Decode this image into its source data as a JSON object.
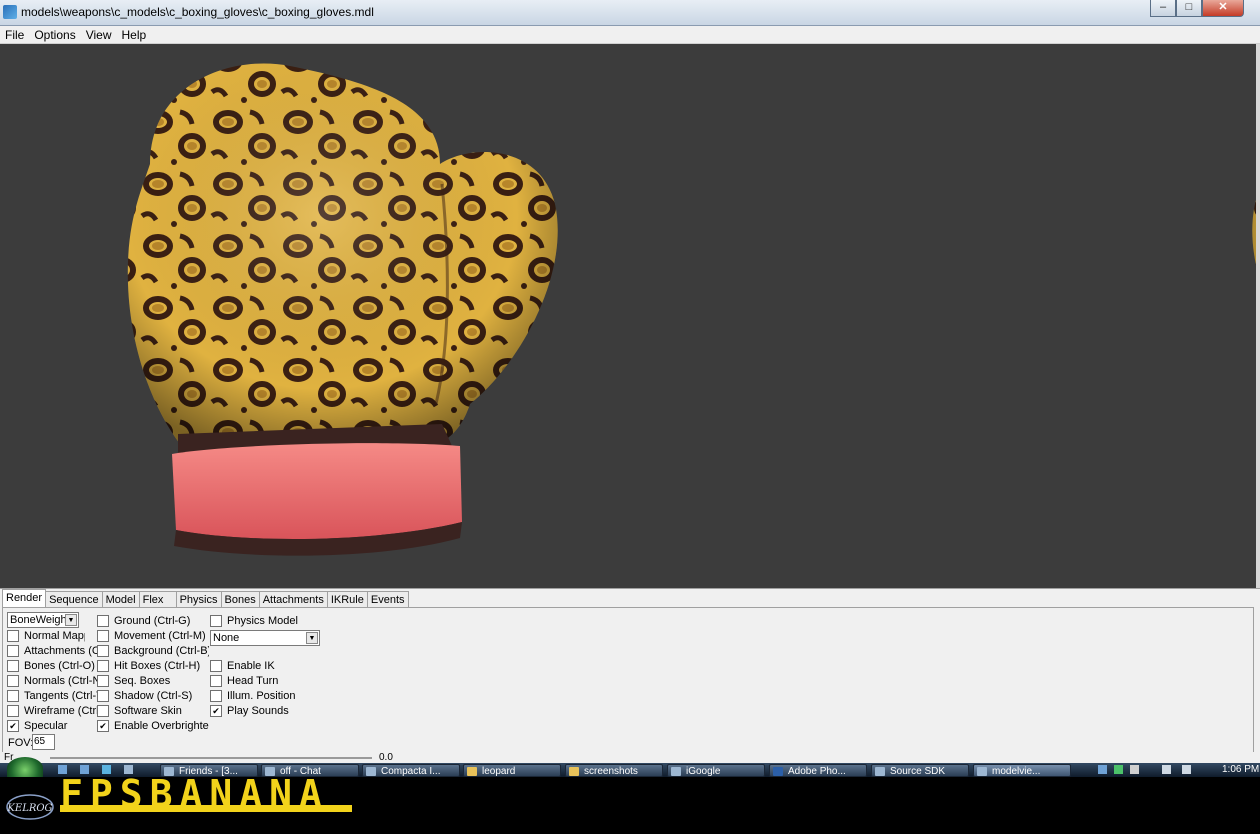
{
  "window": {
    "title": "models\\weapons\\c_models\\c_boxing_gloves\\c_boxing_gloves.mdl",
    "controls": {
      "minimize": "–",
      "maximize": "□",
      "close": "✕"
    }
  },
  "menu": [
    "File",
    "Options",
    "View",
    "Help"
  ],
  "viewport": {
    "background": "#3c3c3c",
    "fur_color": "#e0b240",
    "spot_color": "#3a1f12",
    "cuff_color": "#ef6f6f"
  },
  "tabs": [
    "Render",
    "Sequence",
    "Model",
    "Flex",
    "Physics",
    "Bones",
    "Attachments",
    "IKRule",
    "Events"
  ],
  "render": {
    "render_mode": "BoneWeigh",
    "col1": [
      {
        "label": "Normal Mapp",
        "checked": false
      },
      {
        "label": "Attachments (Ctrl",
        "checked": false
      },
      {
        "label": "Bones (Ctrl-O)",
        "checked": false
      },
      {
        "label": "Normals (Ctrl-N)",
        "checked": false
      },
      {
        "label": "Tangents (Ctrl-T)",
        "checked": false
      },
      {
        "label": "Wireframe (Ctrl-V",
        "checked": false
      },
      {
        "label": "Specular",
        "checked": true
      }
    ],
    "col2": [
      {
        "label": "Ground (Ctrl-G)",
        "checked": false
      },
      {
        "label": "Movement (Ctrl-M)",
        "checked": false
      },
      {
        "label": "Background (Ctrl-B)",
        "checked": false
      },
      {
        "label": "Hit Boxes (Ctrl-H)",
        "checked": false
      },
      {
        "label": "Seq. Boxes",
        "checked": false
      },
      {
        "label": "Shadow (Ctrl-S)",
        "checked": false
      },
      {
        "label": "Software Skin",
        "checked": false
      },
      {
        "label": "Enable Overbrightenin",
        "checked": true
      }
    ],
    "physics_model": {
      "label": "Physics Model",
      "checked": false
    },
    "physics_select": "None",
    "col3": [
      {
        "label": "Enable IK",
        "checked": false
      },
      {
        "label": "Head Turn",
        "checked": false
      },
      {
        "label": "Illum. Position",
        "checked": false
      },
      {
        "label": "Play Sounds",
        "checked": true
      }
    ],
    "fov_label": "FOV:",
    "fov_value": "65",
    "frame_label": "Fr",
    "frame_value": "0.0"
  },
  "taskbar": {
    "items": [
      "Friends - [3...",
      "off - Chat",
      "Compacta I...",
      "leopard",
      "screenshots",
      "iGoogle",
      "Adobe Pho...",
      "Source SDK",
      "modelvie..."
    ],
    "clock": "1:06 PM"
  },
  "banner": {
    "text": "FPSBANANA",
    "logo_text": "KELROG",
    "accent": "#f2d31b"
  }
}
